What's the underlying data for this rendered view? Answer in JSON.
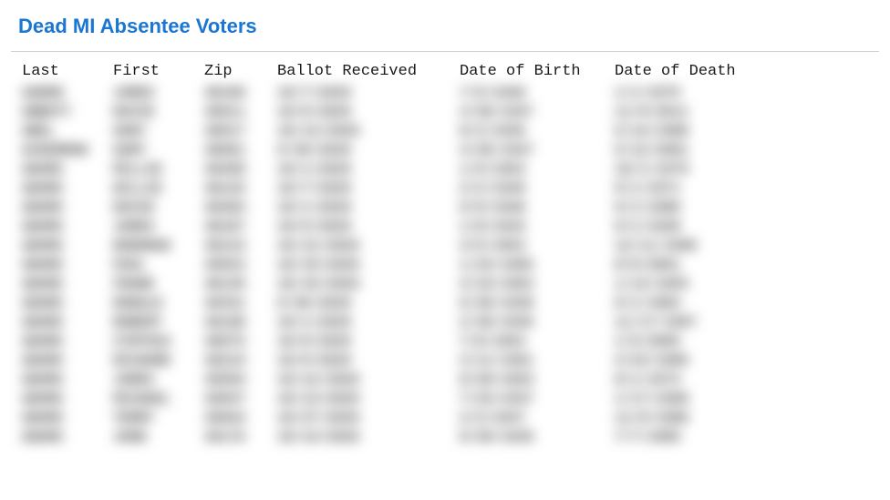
{
  "title": "Dead MI Absentee Voters",
  "headers": {
    "last": "Last",
    "first": "First",
    "zip": "Zip",
    "ballot": "Ballot Received",
    "dob": "Date of Birth",
    "dod": "Date of Death"
  },
  "rows": [
    {
      "last": "AARON",
      "first": "JAMES",
      "zip": "48108",
      "ballot": "10/7/2020",
      "dob": "7/5/1940",
      "dod": "1/1/1975"
    },
    {
      "last": "ABBOTT",
      "first": "DAVID",
      "zip": "48911",
      "ballot": "10/9/2020",
      "dob": "3/30/1937",
      "dod": "11/9/2011"
    },
    {
      "last": "ABEL",
      "first": "GARY",
      "zip": "48917",
      "ballot": "10/14/2020",
      "dob": "8/3/1936",
      "dob2": "",
      "dod": "5/14/1988"
    },
    {
      "last": "ACKERMAN",
      "first": "GARY",
      "zip": "48001",
      "ballot": "9/30/2020",
      "dob": "3/30/1947",
      "dod": "5/12/2001"
    },
    {
      "last": "ADAMS",
      "first": "MILLIE",
      "zip": "48498",
      "ballot": "10/1/2020",
      "dob": "1/9/1953",
      "dod": "10/1/1979"
    },
    {
      "last": "ADAMS",
      "first": "WILLIE",
      "zip": "48126",
      "ballot": "10/7/2020",
      "dob": "2/2/1949",
      "dod": "9/1/1971"
    },
    {
      "last": "ADAMS",
      "first": "DAVID",
      "zip": "48384",
      "ballot": "10/1/2020",
      "dob": "6/9/1948",
      "dod": "9/1/1988"
    },
    {
      "last": "ADAMS",
      "first": "JAMES",
      "zip": "48187",
      "ballot": "10/5/2020",
      "dob": "1/8/1934",
      "dod": "9/1/1948"
    },
    {
      "last": "ADAMS",
      "first": "DEBORAH",
      "zip": "48124",
      "ballot": "10/12/2020",
      "dob": "4/5/1953",
      "dod": "12/11/1998"
    },
    {
      "last": "ADAMS",
      "first": "PAUL",
      "zip": "49923",
      "ballot": "10/19/2020",
      "dob": "1/23/1955",
      "dod": "8/9/2001"
    },
    {
      "last": "ADAMS",
      "first": "FRANK",
      "zip": "48139",
      "ballot": "10/19/2020",
      "dob": "4/19/1963",
      "dod": "1/13/1993"
    },
    {
      "last": "ADAMS",
      "first": "DONALD",
      "zip": "49431",
      "ballot": "9/30/2020",
      "dob": "6/30/1938",
      "dod": "9/1/1984"
    },
    {
      "last": "ADAMS",
      "first": "ROBERT",
      "zip": "48108",
      "ballot": "10/1/2020",
      "dob": "2/30/1936",
      "dod": "11/17/1997"
    },
    {
      "last": "ADAMS",
      "first": "CYNTHIA",
      "zip": "48075",
      "ballot": "10/9/2020",
      "dob": "7/8/1953",
      "dod": "1/5/2005"
    },
    {
      "last": "ADAMS",
      "first": "RICHARD",
      "zip": "48219",
      "ballot": "10/9/2020",
      "dob": "3/11/1951",
      "dod": "4/23/1989"
    },
    {
      "last": "ADAMS",
      "first": "JAMES",
      "zip": "49504",
      "ballot": "10/12/2020",
      "dob": "8/28/1953",
      "dod": "8/1/1974"
    },
    {
      "last": "ADAMS",
      "first": "MICHAEL",
      "zip": "49047",
      "ballot": "10/13/2020",
      "dob": "7/24/1937",
      "dod": "1/17/1998"
    },
    {
      "last": "ADAMS",
      "first": "TERRY",
      "zip": "49844",
      "ballot": "10/27/2020",
      "dob": "2/3/1947",
      "dod": "11/9/1988"
    },
    {
      "last": "ADAMS",
      "first": "JOHN",
      "zip": "49176",
      "ballot": "10/14/2020",
      "dob": "8/30/1939",
      "dod": "7/7/1989"
    }
  ]
}
